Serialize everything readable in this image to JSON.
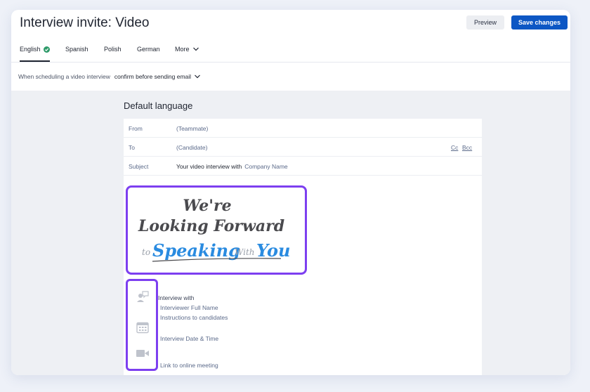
{
  "header": {
    "title": "Interview invite: Video",
    "preview_label": "Preview",
    "save_label": "Save changes"
  },
  "tabs": [
    {
      "label": "English",
      "active": true,
      "verified": true
    },
    {
      "label": "Spanish",
      "active": false
    },
    {
      "label": "Polish",
      "active": false
    },
    {
      "label": "German",
      "active": false
    },
    {
      "label": "More",
      "active": false,
      "dropdown": true
    }
  ],
  "setting": {
    "label": "When scheduling a video interview",
    "value": "confirm before sending email"
  },
  "section_title": "Default language",
  "email": {
    "from_label": "From",
    "from_value": "(Teammate)",
    "to_label": "To",
    "to_value": "(Candidate)",
    "cc": "Cc",
    "bcc": "Bcc",
    "subject_label": "Subject",
    "subject_text": "Your video interview with",
    "subject_var": "Company Name"
  },
  "banner": {
    "line1": "We're",
    "line2": "Looking Forward",
    "to": "to",
    "speaking": "Speaking",
    "with": "With",
    "you": "You"
  },
  "body": {
    "interview_with": "Interview with",
    "interviewer": "Interviewer Full Name",
    "instructions": "Instructions to candidates",
    "datetime": "Interview Date & Time",
    "meeting": "Link to online meeting"
  },
  "colors": {
    "primary": "#0d57c4",
    "highlight": "#7d3ff0",
    "verified": "#2f9b6a",
    "variable": "#5b6a8a",
    "banner_blue": "#2a8be0"
  },
  "icons": [
    "check-icon",
    "chevron-down-icon",
    "person-chat-icon",
    "calendar-icon",
    "video-camera-icon"
  ]
}
